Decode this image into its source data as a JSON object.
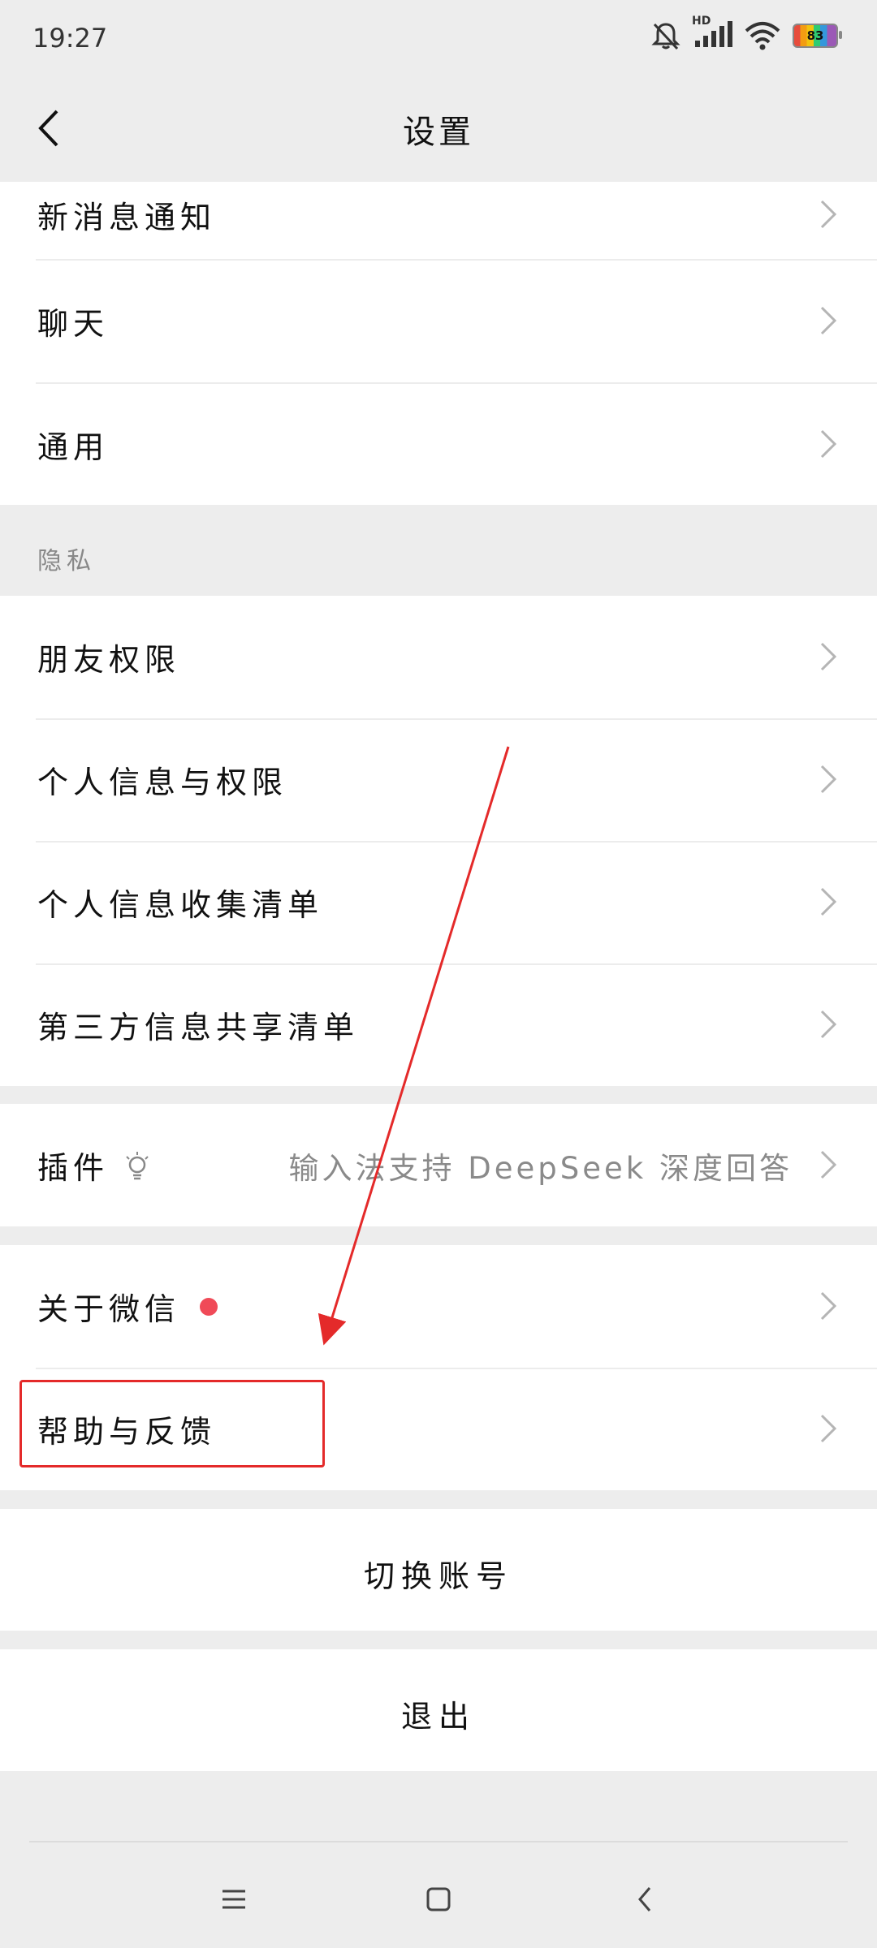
{
  "status_bar": {
    "time": "19:27",
    "network_label": "HD",
    "battery": "83",
    "icons": [
      "bell-off-icon",
      "signal-icon",
      "wifi-icon",
      "battery-icon"
    ]
  },
  "header": {
    "title": "设置",
    "back_icon": "chevron-left-icon"
  },
  "top_section": {
    "items": [
      {
        "label": "新消息通知"
      },
      {
        "label": "聊天"
      },
      {
        "label": "通用"
      }
    ]
  },
  "privacy_section": {
    "title": "隐私",
    "items": [
      {
        "label": "朋友权限"
      },
      {
        "label": "个人信息与权限"
      },
      {
        "label": "个人信息收集清单"
      },
      {
        "label": "第三方信息共享清单"
      }
    ]
  },
  "plugins": {
    "label": "插件",
    "icon": "lightbulb-icon",
    "value": "输入法支持 DeepSeek 深度回答"
  },
  "about_section": {
    "items": [
      {
        "label": "关于微信",
        "badge": "red-dot"
      },
      {
        "label": "帮助与反馈"
      }
    ]
  },
  "actions": {
    "switch_account": "切换账号",
    "logout": "退出"
  },
  "annotation": {
    "arrow_color": "#e42a2a",
    "box_color": "#e42a2a"
  },
  "nav_bar": {
    "icons": [
      "menu-icon",
      "home-icon",
      "back-icon"
    ]
  }
}
